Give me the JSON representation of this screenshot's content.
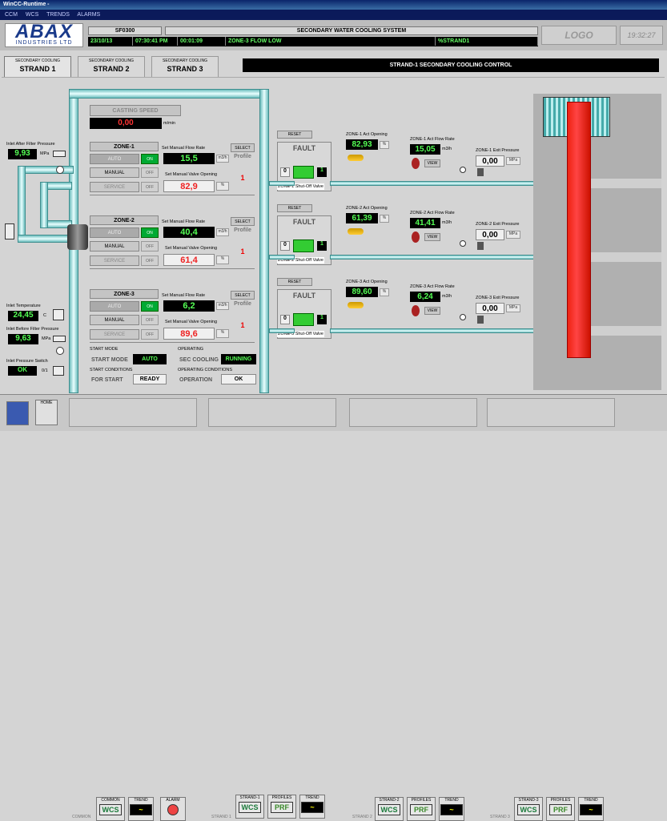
{
  "app": {
    "title": "WinCC-Runtime -",
    "menu": [
      "CCM",
      "WCS",
      "TRENDS",
      "ALARMS"
    ]
  },
  "header": {
    "logo_main": "ABAX",
    "logo_sub": "INDUSTRIES LTD",
    "code": "SF0300",
    "system": "SECONDARY WATER COOLING SYSTEM",
    "date": "23/10/13",
    "time": "07:30:41 PM",
    "elapsed": "00:01:09",
    "alarm": "ZONE-3 FLOW LOW",
    "strand": "%STRAND1",
    "logo2": "LOGO",
    "clock": "19:32:27"
  },
  "tabs": [
    {
      "small": "SECONDARY COOLING",
      "big": "STRAND 1"
    },
    {
      "small": "SECONDARY COOLING",
      "big": "STRAND 2"
    },
    {
      "small": "SECONDARY COOLING",
      "big": "STRAND 3"
    }
  ],
  "tab_title": "STRAND-1 SECONDARY COOLING CONTROL",
  "left": {
    "after_filter_label": "Inlet After Filter Pressure",
    "after_filter": "9,93",
    "mpa": "MPa",
    "temp_label": "Inlet Temperature",
    "temp": "24,45",
    "temp_unit": "C",
    "before_filter_label": "Inlet Before Filter Pressure",
    "before_filter": "9,63",
    "switch_label": "Inlet Pressure Switch",
    "switch": "OK",
    "switch_val": "0/1"
  },
  "casting": {
    "label": "CASTING SPEED",
    "value": "0,00",
    "unit": "m/min"
  },
  "zones": [
    {
      "name": "ZONE-1",
      "auto": "AUTO",
      "on": "ON",
      "manual": "MANUAL",
      "off": "OFF",
      "service": "SERVICE",
      "flow_label": "Set Manual Flow Rate",
      "flow": "15,5",
      "flow_unit": "m3/h",
      "valve_label": "Set Manual Valve Opening",
      "valve": "82,9",
      "pct": "%",
      "select": "SELECT",
      "profile": "Profile",
      "profile_val": "1",
      "reset": "RESET",
      "fault": "FAULT",
      "shut_label": "ZONE-1 Shut-Off Valve",
      "sv0": "0",
      "sv1": "1",
      "act_open_label": "ZONE-1 Act Opening",
      "act_open": "82,93",
      "act_flow_label": "ZONE-1 Act Flow Rate",
      "act_flow": "15,05",
      "view": "VIEW",
      "exit_label": "ZONE-1 Exit Pressure",
      "exit": "0,00",
      "strand_label": "ZONE-1"
    },
    {
      "name": "ZONE-2",
      "auto": "AUTO",
      "on": "ON",
      "manual": "MANUAL",
      "off": "OFF",
      "service": "SERVICE",
      "flow_label": "Set Manual Flow Rate",
      "flow": "40,4",
      "flow_unit": "m3/h",
      "valve_label": "Set Manual Valve Opening",
      "valve": "61,4",
      "pct": "%",
      "select": "SELECT",
      "profile": "Profile",
      "profile_val": "1",
      "reset": "RESET",
      "fault": "FAULT",
      "shut_label": "ZONE-2 Shut-Off Valve",
      "sv0": "0",
      "sv1": "1",
      "act_open_label": "ZONE-2 Act Opening",
      "act_open": "61,39",
      "act_flow_label": "ZONE-2 Act Flow Rate",
      "act_flow": "41,41",
      "view": "VIEW",
      "exit_label": "ZONE-2 Exit Pressure",
      "exit": "0,00",
      "strand_label": "ZONE-2"
    },
    {
      "name": "ZONE-3",
      "auto": "AUTO",
      "on": "ON",
      "manual": "MANUAL",
      "off": "OFF",
      "service": "SERVICE",
      "flow_label": "Set Manual Flow Rate",
      "flow": "6,2",
      "flow_unit": "m3/h",
      "valve_label": "Set Manual Valve Opening",
      "valve": "89,6",
      "pct": "%",
      "select": "SELECT",
      "profile": "Profile",
      "profile_val": "1",
      "reset": "RESET",
      "fault": "FAULT",
      "shut_label": "ZONE-3 Shut-Off Valve",
      "sv0": "0",
      "sv1": "1",
      "act_open_label": "ZONE-3 Act Opening",
      "act_open": "89,60",
      "act_flow_label": "ZONE-3 Act Flow Rate",
      "act_flow": "6,24",
      "view": "VIEW",
      "exit_label": "ZONE-3 Exit Pressure",
      "exit": "0,00",
      "strand_label": "ZONE-3"
    }
  ],
  "status": {
    "start_mode_hdr": "START MODE",
    "start_mode_lbl": "START MODE",
    "start_mode": "AUTO",
    "operating_hdr": "OPERATING",
    "sec_cooling_lbl": "SEC COOLING",
    "sec_cooling": "RUNNING",
    "start_cond_hdr": "START CONDITIONS",
    "for_start_lbl": "FOR START",
    "for_start": "READY",
    "op_cond_hdr": "OPERATING CONDITIONS",
    "operation_lbl": "OPERATION",
    "operation": "OK"
  },
  "footer": {
    "home": "HOME",
    "common": "COMMON",
    "alarm": "ALARM",
    "trend": "TREND",
    "wcs": "WCS",
    "prf": "PRF",
    "profiles": "PROFILES",
    "strand1": "STRAND 1",
    "strand2": "STRAND 2",
    "strand3": "STRAND 3",
    "strand1_btn": "STRAND-1",
    "strand2_btn": "STRAND-2",
    "strand3_btn": "STRAND-3"
  }
}
